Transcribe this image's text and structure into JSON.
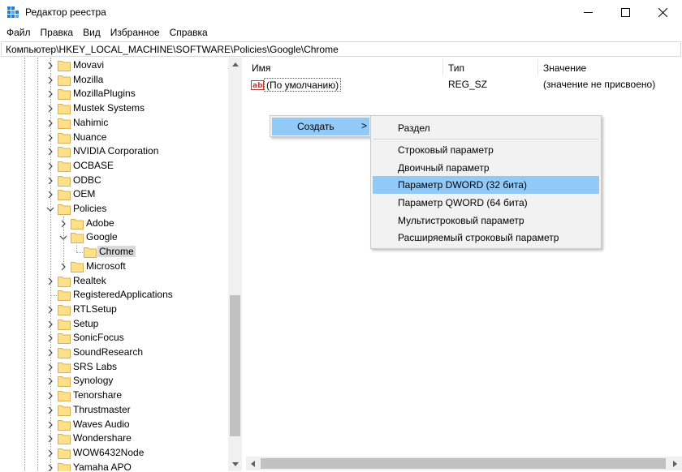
{
  "window": {
    "title": "Редактор реестра",
    "minimize_glyph": "minimize-icon",
    "maximize_glyph": "maximize-icon",
    "close_glyph": "close-icon"
  },
  "menu": [
    "Файл",
    "Правка",
    "Вид",
    "Избранное",
    "Справка"
  ],
  "address": "Компьютер\\HKEY_LOCAL_MACHINE\\SOFTWARE\\Policies\\Google\\Chrome",
  "tree": {
    "items": [
      {
        "label": "Movavi",
        "level": 0,
        "expander": "collapsed"
      },
      {
        "label": "Mozilla",
        "level": 0,
        "expander": "collapsed"
      },
      {
        "label": "MozillaPlugins",
        "level": 0,
        "expander": "collapsed"
      },
      {
        "label": "Mustek Systems",
        "level": 0,
        "expander": "collapsed"
      },
      {
        "label": "Nahimic",
        "level": 0,
        "expander": "collapsed"
      },
      {
        "label": "Nuance",
        "level": 0,
        "expander": "collapsed"
      },
      {
        "label": "NVIDIA Corporation",
        "level": 0,
        "expander": "collapsed"
      },
      {
        "label": "OCBASE",
        "level": 0,
        "expander": "collapsed"
      },
      {
        "label": "ODBC",
        "level": 0,
        "expander": "collapsed"
      },
      {
        "label": "OEM",
        "level": 0,
        "expander": "collapsed"
      },
      {
        "label": "Policies",
        "level": 0,
        "expander": "expanded"
      },
      {
        "label": "Adobe",
        "level": 1,
        "expander": "collapsed"
      },
      {
        "label": "Google",
        "level": 1,
        "expander": "expanded"
      },
      {
        "label": "Chrome",
        "level": 2,
        "expander": "none",
        "selected": true
      },
      {
        "label": "Microsoft",
        "level": 1,
        "expander": "collapsed"
      },
      {
        "label": "Realtek",
        "level": 0,
        "expander": "collapsed"
      },
      {
        "label": "RegisteredApplications",
        "level": 0,
        "expander": "none"
      },
      {
        "label": "RTLSetup",
        "level": 0,
        "expander": "collapsed"
      },
      {
        "label": "Setup",
        "level": 0,
        "expander": "collapsed"
      },
      {
        "label": "SonicFocus",
        "level": 0,
        "expander": "collapsed"
      },
      {
        "label": "SoundResearch",
        "level": 0,
        "expander": "collapsed"
      },
      {
        "label": "SRS Labs",
        "level": 0,
        "expander": "collapsed"
      },
      {
        "label": "Synology",
        "level": 0,
        "expander": "collapsed"
      },
      {
        "label": "Tenorshare",
        "level": 0,
        "expander": "collapsed"
      },
      {
        "label": "Thrustmaster",
        "level": 0,
        "expander": "collapsed"
      },
      {
        "label": "Waves Audio",
        "level": 0,
        "expander": "collapsed"
      },
      {
        "label": "Wondershare",
        "level": 0,
        "expander": "collapsed"
      },
      {
        "label": "WOW6432Node",
        "level": 0,
        "expander": "collapsed"
      },
      {
        "label": "Yamaha APO",
        "level": 0,
        "expander": "collapsed"
      }
    ]
  },
  "list": {
    "headers": {
      "name": "Имя",
      "type": "Тип",
      "value": "Значение"
    },
    "rows": [
      {
        "icon": "string-value-icon",
        "name": "(По умолчанию)",
        "type": "REG_SZ",
        "value": "(значение не присвоено)"
      }
    ]
  },
  "context_menu": {
    "parent": {
      "label": "Создать",
      "arrow": ">"
    },
    "submenu": [
      {
        "label": "Раздел"
      },
      {
        "label": "Строковый параметр"
      },
      {
        "label": "Двоичный параметр"
      },
      {
        "label": "Параметр DWORD (32 бита)",
        "highlighted": true
      },
      {
        "label": "Параметр QWORD (64 бита)"
      },
      {
        "label": "Мультистроковый параметр"
      },
      {
        "label": "Расширяемый строковый параметр"
      }
    ]
  },
  "colors": {
    "highlight": "#91c9f7",
    "folder": "#ffe08a",
    "folder_border": "#dcb14d",
    "selection": "#d9d9d9",
    "icon_blue": "#1e7fd8"
  }
}
